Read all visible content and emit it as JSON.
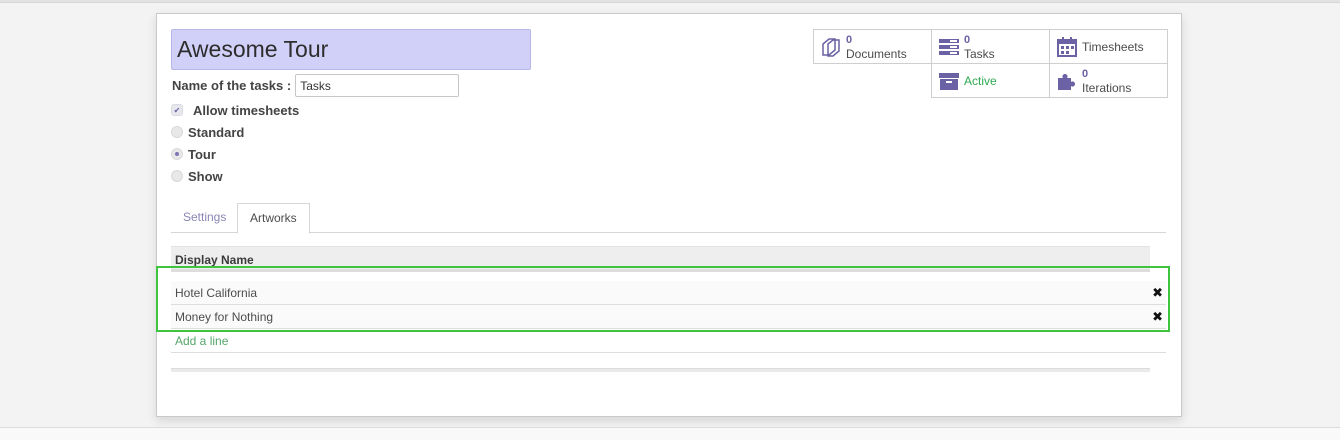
{
  "project": {
    "name": "Awesome Tour",
    "task_label": "Name of the tasks :",
    "task_value": "Tasks"
  },
  "options": {
    "allow_timesheets": {
      "label": "Allow timesheets",
      "checked": true
    },
    "types": [
      {
        "label": "Standard",
        "selected": false
      },
      {
        "label": "Tour",
        "selected": true
      },
      {
        "label": "Show",
        "selected": false
      }
    ]
  },
  "stats": {
    "documents": {
      "count": "0",
      "label": "Documents",
      "icon": "documents-icon"
    },
    "tasks": {
      "count": "0",
      "label": "Tasks",
      "icon": "tasks-icon"
    },
    "timesheets": {
      "label": "Timesheets",
      "icon": "calendar-icon"
    },
    "active": {
      "label": "Active",
      "icon": "archive-box-icon"
    },
    "iterations": {
      "count": "0",
      "label": "Iterations",
      "icon": "puzzle-icon"
    }
  },
  "tabs": [
    {
      "label": "Settings",
      "active": false
    },
    {
      "label": "Artworks",
      "active": true
    }
  ],
  "artworks": {
    "column": "Display Name",
    "rows": [
      "Hotel California",
      "Money for Nothing"
    ],
    "add_line": "Add a line",
    "delete_glyph": "✖"
  },
  "colors": {
    "accent": "#6a62a4",
    "title_bg": "#d1d0f8",
    "active_green": "#2eaa52",
    "highlight": "#3ec43e"
  }
}
